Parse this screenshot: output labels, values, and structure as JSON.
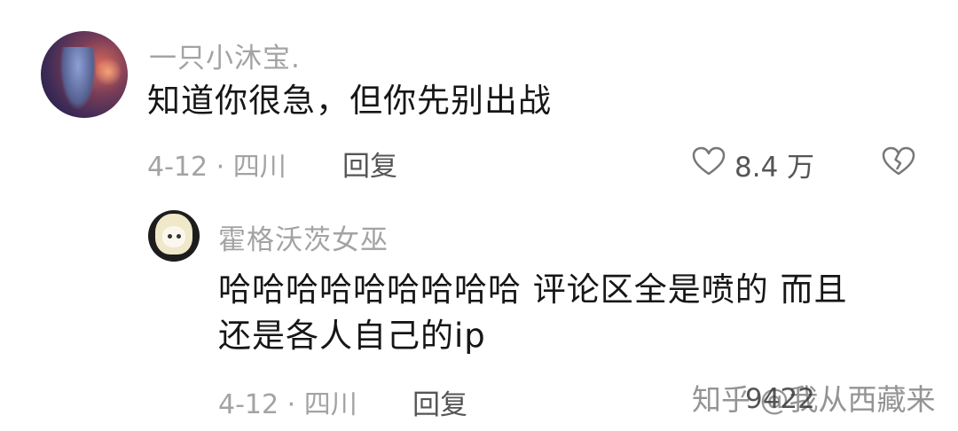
{
  "comment": {
    "username": "一只小沐宝.",
    "text": "知道你很急，但你先别出战",
    "date_location": "4-12 · 四川",
    "reply_label": "回复",
    "like_count": "8.4 万"
  },
  "reply": {
    "username": "霍格沃茨女巫",
    "text_line1": "哈哈哈哈哈哈哈哈哈 评论区全是喷的 而且",
    "text_line2": "还是各人自己的ip",
    "date_location": "4-12 · 四川",
    "reply_label": "回复",
    "like_count": "9422"
  },
  "watermark": "知乎 @我从西藏来"
}
